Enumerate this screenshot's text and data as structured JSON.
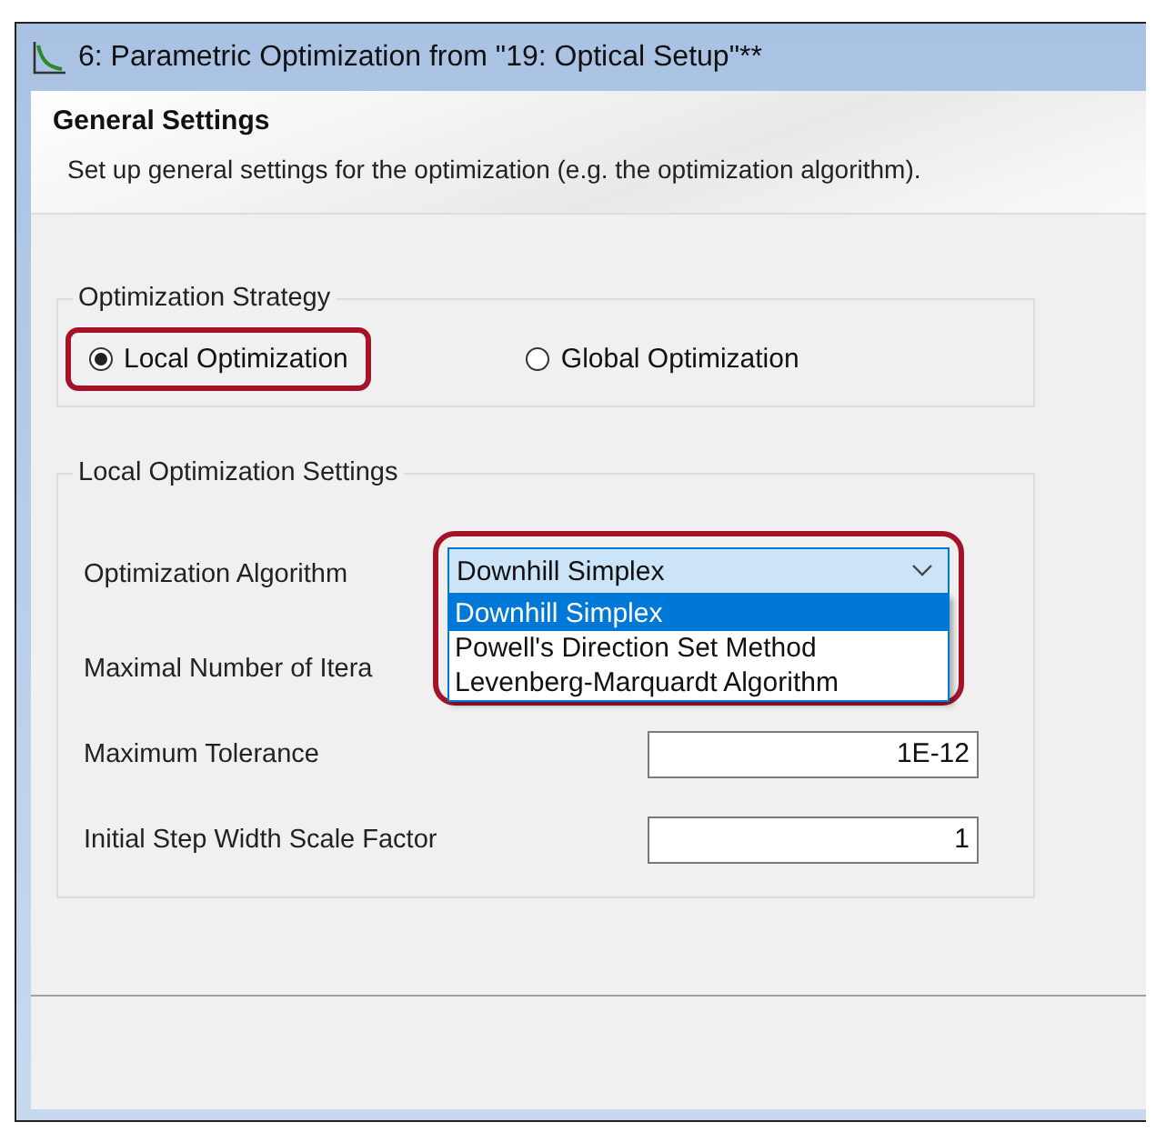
{
  "window": {
    "title": "6: Parametric Optimization from \"19: Optical Setup\"**"
  },
  "header": {
    "title": "General Settings",
    "description": "Set up general settings for the optimization (e.g. the optimization algorithm)."
  },
  "strategy": {
    "legend": "Optimization Strategy",
    "options": [
      {
        "label": "Local Optimization",
        "selected": true,
        "highlighted": true
      },
      {
        "label": "Global Optimization",
        "selected": false,
        "highlighted": false
      }
    ]
  },
  "local_settings": {
    "legend": "Local Optimization Settings",
    "algorithm": {
      "label": "Optimization Algorithm",
      "value": "Downhill Simplex",
      "highlighted": true,
      "expanded": true,
      "options": [
        {
          "label": "Downhill Simplex",
          "selected": true
        },
        {
          "label": "Powell's Direction Set Method",
          "selected": false
        },
        {
          "label": "Levenberg-Marquardt Algorithm",
          "selected": false
        }
      ]
    },
    "fields": [
      {
        "label": "Maximal Number of Itera"
      },
      {
        "label": "Maximum Tolerance",
        "value": "1E-12"
      },
      {
        "label": "Initial Step Width Scale Factor",
        "value": "1"
      }
    ]
  }
}
